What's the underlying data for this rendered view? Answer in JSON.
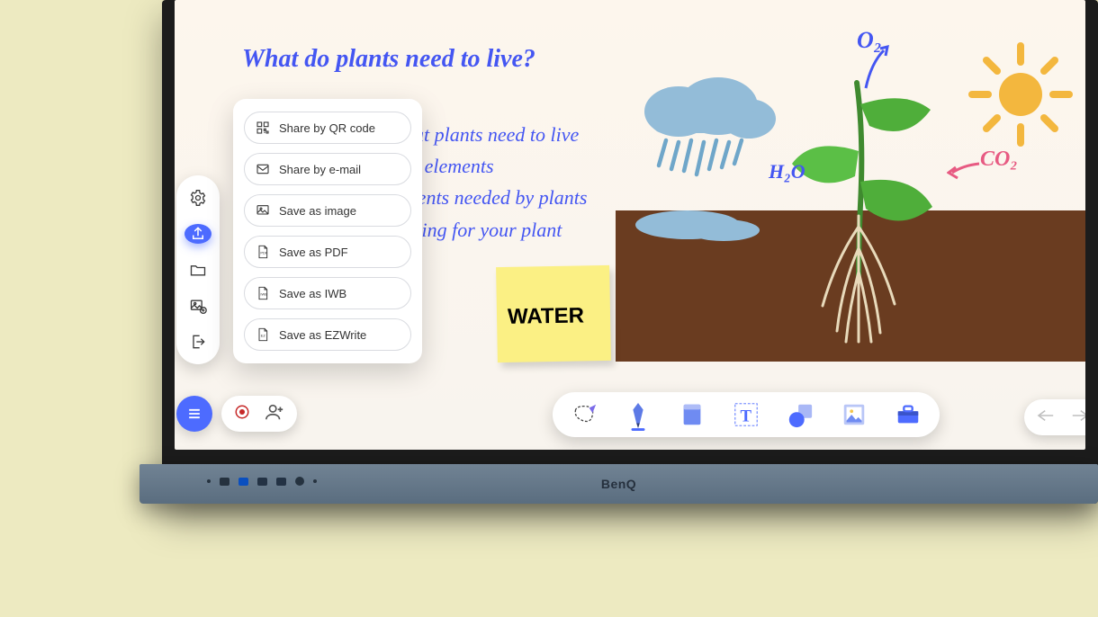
{
  "board": {
    "brand": "BenQ",
    "title": "What do plants need to live?",
    "body": "hat plants need to live\nal elements\nrients needed by plants\naring for your plant",
    "sticky": "WATER",
    "labels": {
      "h2o": "H₂O",
      "o2": "O₂",
      "co2": "CO₂"
    }
  },
  "share_menu": {
    "items": [
      {
        "id": "qr",
        "label": "Share by QR code"
      },
      {
        "id": "email",
        "label": "Share by e-mail"
      },
      {
        "id": "image",
        "label": "Save as image"
      },
      {
        "id": "pdf",
        "label": "Save as PDF"
      },
      {
        "id": "iwb",
        "label": "Save as IWB"
      },
      {
        "id": "ez",
        "label": "Save as EZWrite"
      }
    ]
  },
  "sidebar": {
    "items": [
      {
        "id": "settings",
        "name": "gear-icon"
      },
      {
        "id": "share",
        "name": "share-icon",
        "active": true
      },
      {
        "id": "folder",
        "name": "folder-icon"
      },
      {
        "id": "add-img",
        "name": "add-image-icon"
      },
      {
        "id": "exit",
        "name": "exit-icon"
      }
    ]
  },
  "bottom_left": {
    "menu": "menu-icon",
    "record": "record-icon",
    "add_user": "add-person-icon"
  },
  "tools": [
    {
      "id": "select",
      "name": "lasso-icon"
    },
    {
      "id": "pen",
      "name": "pen-icon"
    },
    {
      "id": "eraser",
      "name": "eraser-icon"
    },
    {
      "id": "text",
      "name": "text-icon"
    },
    {
      "id": "shapes",
      "name": "shapes-icon"
    },
    {
      "id": "image",
      "name": "image-icon"
    },
    {
      "id": "toolbox",
      "name": "toolbox-icon"
    }
  ],
  "right_tools": [
    {
      "id": "undo",
      "name": "undo-icon"
    },
    {
      "id": "redo",
      "name": "redo-icon"
    },
    {
      "id": "page",
      "name": "page-icon"
    }
  ],
  "colors": {
    "accent": "#4d6bff",
    "ink": "#4456f2",
    "pink": "#e75a82",
    "sticky": "#fbf084",
    "soil": "#6a3c20"
  }
}
